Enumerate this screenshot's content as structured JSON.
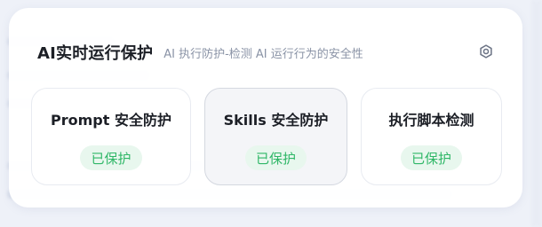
{
  "panel": {
    "title": "AI实时运行保护",
    "subtitle": "AI 执行防护-检测 AI 运行行为的安全性",
    "settings_icon": "gear-icon"
  },
  "cards": [
    {
      "title": "Prompt 安全防护",
      "status": "已保护",
      "selected": false
    },
    {
      "title": "Skills 安全防护",
      "status": "已保护",
      "selected": true
    },
    {
      "title": "执行脚本检测",
      "status": "已保护",
      "selected": false
    }
  ],
  "colors": {
    "status_text": "#2fb767",
    "status_bg": "#e8f7ee",
    "selected_card_bg": "#f4f5f8"
  }
}
